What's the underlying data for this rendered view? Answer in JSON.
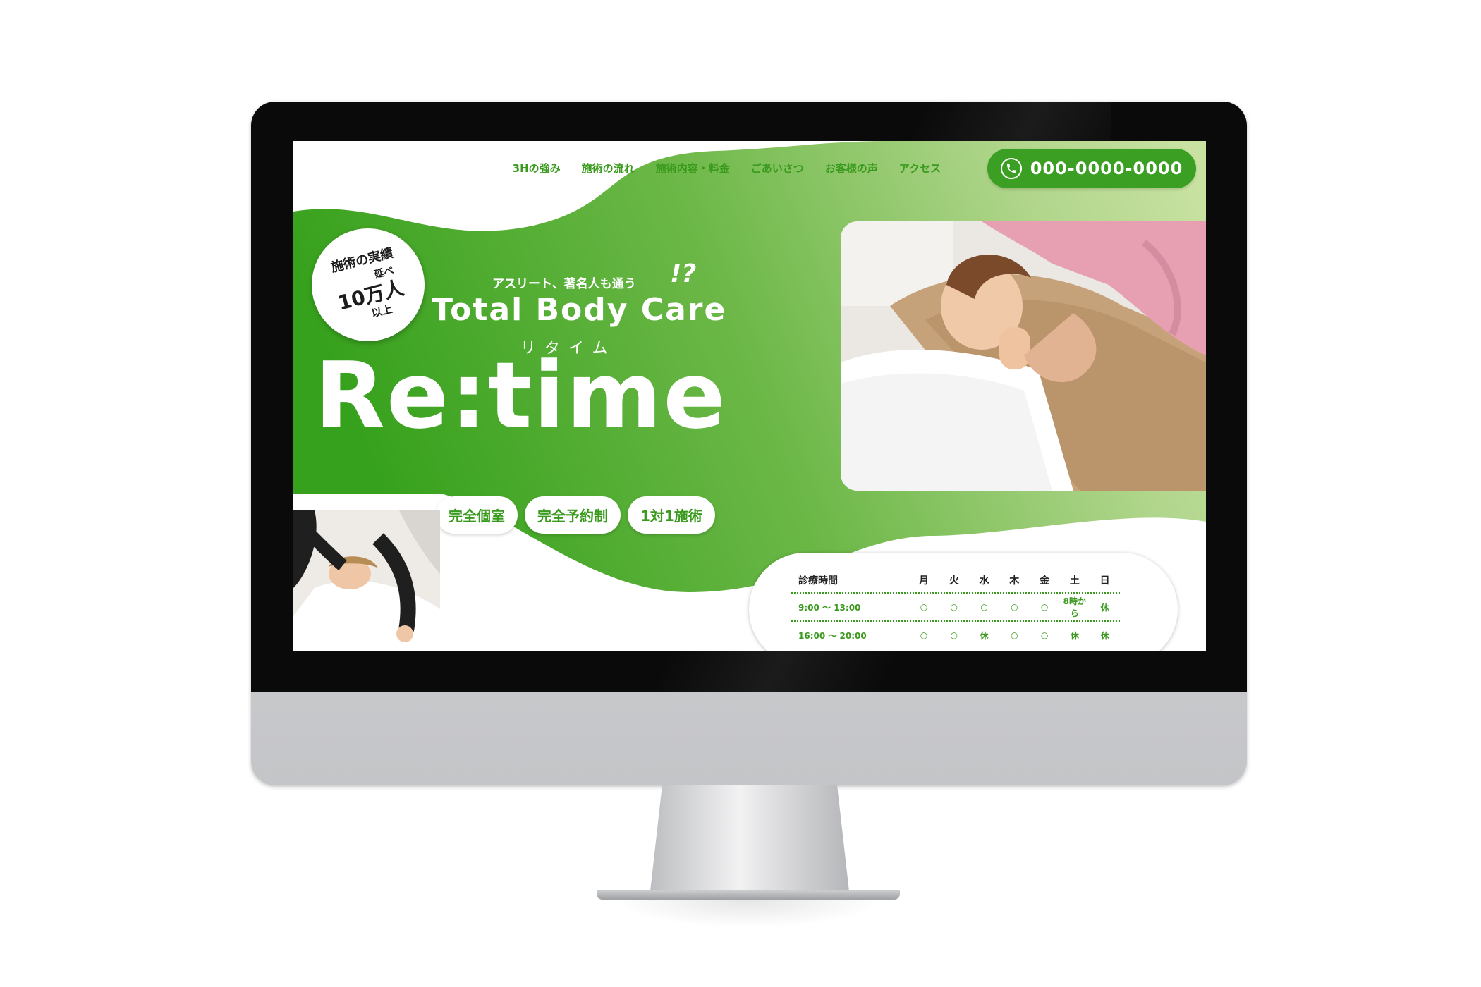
{
  "nav": {
    "items": [
      "3Hの強み",
      "施術の流れ",
      "施術内容・料金",
      "ごあいさつ",
      "お客様の声",
      "アクセス"
    ],
    "phone": "000-0000-0000"
  },
  "hero": {
    "badge": {
      "line1": "施術の実績",
      "line2": "延べ",
      "line3": "10万人",
      "line4": "以上"
    },
    "tagline": "アスリート、著名人も通う",
    "tagline_mark": "!?",
    "subtitle": "Total Body Care",
    "furigana": "リタイム",
    "logo": "Re:time"
  },
  "pills": [
    "完全個室",
    "完全予約制",
    "1対1施術"
  ],
  "schedule": {
    "header": [
      "診療時間",
      "月",
      "火",
      "水",
      "木",
      "金",
      "土",
      "日"
    ],
    "rows": [
      {
        "time": "9:00 〜 13:00",
        "cells": [
          "○",
          "○",
          "○",
          "○",
          "○",
          "8時から",
          "休"
        ]
      },
      {
        "time": "16:00 〜 20:00",
        "cells": [
          "○",
          "○",
          "休",
          "○",
          "○",
          "休",
          "休"
        ]
      }
    ]
  },
  "colors": {
    "accent": "#3a9f22",
    "light_green": "#c8e0a0",
    "text_green": "#3a9a1e"
  },
  "icons": {
    "phone": "phone-icon"
  }
}
